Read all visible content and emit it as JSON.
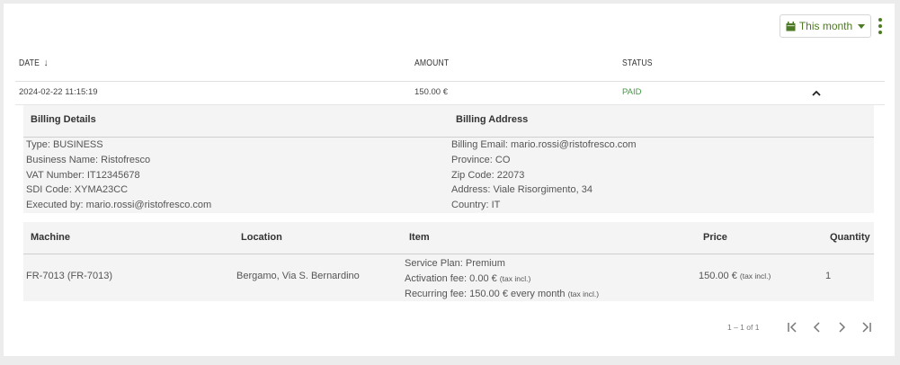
{
  "toolbar": {
    "filter_label": "This month",
    "filter_icon": "calendar-icon",
    "menu_icon": "kebab-menu-icon"
  },
  "table": {
    "headers": {
      "date": "DATE",
      "amount": "AMOUNT",
      "status": "STATUS"
    },
    "sort_icon": "arrow-down-icon",
    "row": {
      "date": "2024-02-22 11:15:19",
      "amount": "150.00 €",
      "status": "PAID",
      "expand_icon": "chevron-up-icon"
    }
  },
  "billing": {
    "details_title": "Billing Details",
    "address_title": "Billing Address",
    "details": [
      "Type: BUSINESS",
      "Business Name: Ristofresco",
      "VAT Number: IT12345678",
      "SDI Code: XYMA23CC",
      "Executed by: mario.rossi@ristofresco.com"
    ],
    "address": [
      "Billing Email: mario.rossi@ristofresco.com",
      "Province: CO",
      "Zip Code: 22073",
      "Address: Viale Risorgimento, 34",
      "Country: IT"
    ]
  },
  "items": {
    "headers": {
      "machine": "Machine",
      "location": "Location",
      "item": "Item",
      "price": "Price",
      "quantity": "Quantity"
    },
    "row": {
      "machine": "FR-7013 (FR-7013)",
      "location": "Bergamo, Via S. Bernardino",
      "plan": "Service Plan: Premium",
      "activation": "Activation fee: 0.00 €",
      "recurring": "Recurring fee: 150.00 € every month",
      "tax_note": "(tax incl.)",
      "price": "150.00 €",
      "quantity": "1"
    }
  },
  "pagination": {
    "range": "1 – 1 of 1",
    "first_icon": "first-page-icon",
    "prev_icon": "previous-page-icon",
    "next_icon": "next-page-icon",
    "last_icon": "last-page-icon"
  },
  "colors": {
    "accent": "#4d7a24",
    "paid": "#3f9a3f",
    "panel": "#f4f4f4"
  }
}
